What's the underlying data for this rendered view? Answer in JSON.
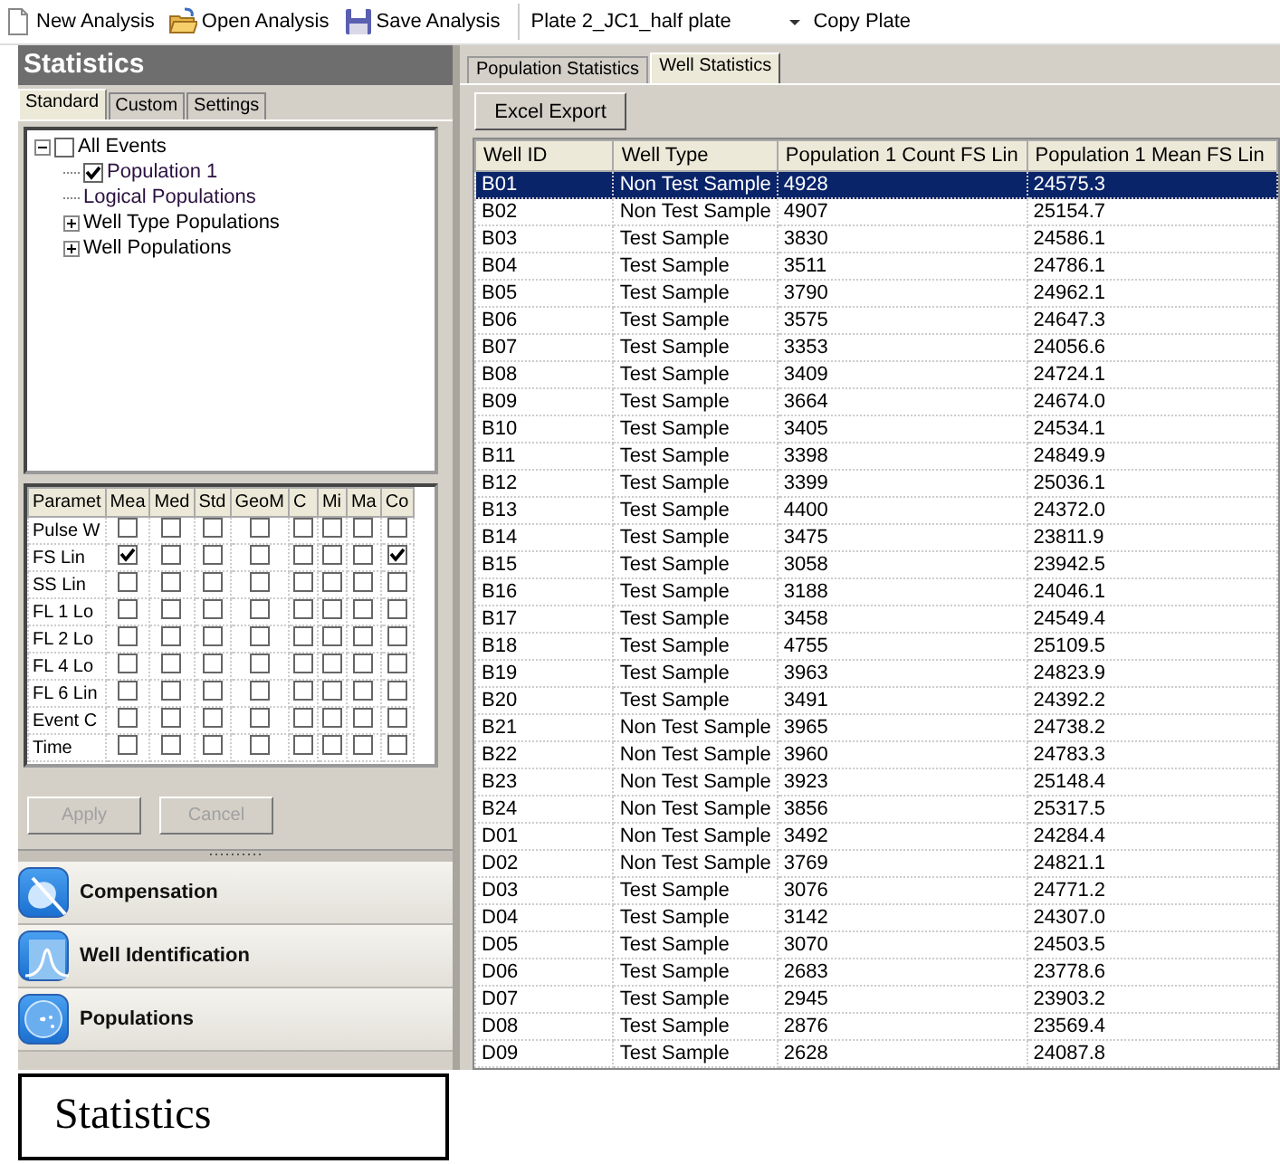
{
  "toolbar": {
    "buttons": [
      {
        "label": "New Analysis",
        "kind": "new"
      },
      {
        "label": "Open Analysis",
        "kind": "open"
      },
      {
        "label": "Save Analysis",
        "kind": "save"
      }
    ],
    "plate_select": {
      "value": "Plate 2_JC1_half plate"
    },
    "copy_plate": "Copy Plate"
  },
  "panel": {
    "title": "Statistics",
    "tabs": [
      {
        "label": "Standard",
        "selected": true
      },
      {
        "label": "Custom",
        "selected": false
      },
      {
        "label": "Settings",
        "selected": false
      }
    ],
    "tree": [
      {
        "label": "All Events",
        "kind": "checkgroup",
        "checked": false,
        "expanded": true,
        "children": [
          {
            "label": "Population 1",
            "kind": "check",
            "checked": true
          },
          {
            "label": "Logical Populations",
            "kind": "leaf"
          },
          {
            "label": "Well Type Populations",
            "kind": "group",
            "expanded": false
          },
          {
            "label": "Well Populations",
            "kind": "group",
            "expanded": false
          }
        ]
      }
    ],
    "param_columns": [
      "Paramet",
      "Mea",
      "Med",
      "Std",
      "GeoM",
      "C",
      "Mi",
      "Ma",
      "Co"
    ],
    "params": [
      {
        "name": "Pulse W",
        "checks": [
          false,
          false,
          false,
          false,
          false,
          false,
          false,
          false
        ]
      },
      {
        "name": "FS Lin",
        "checks": [
          true,
          false,
          false,
          false,
          false,
          false,
          false,
          true
        ]
      },
      {
        "name": "SS Lin",
        "checks": [
          false,
          false,
          false,
          false,
          false,
          false,
          false,
          false
        ]
      },
      {
        "name": "FL 1 Lo",
        "checks": [
          false,
          false,
          false,
          false,
          false,
          false,
          false,
          false
        ]
      },
      {
        "name": "FL 2 Lo",
        "checks": [
          false,
          false,
          false,
          false,
          false,
          false,
          false,
          false
        ]
      },
      {
        "name": "FL 4 Lo",
        "checks": [
          false,
          false,
          false,
          false,
          false,
          false,
          false,
          false
        ]
      },
      {
        "name": "FL 6 Lin",
        "checks": [
          false,
          false,
          false,
          false,
          false,
          false,
          false,
          false
        ]
      },
      {
        "name": "Event C",
        "checks": [
          false,
          false,
          false,
          false,
          false,
          false,
          false,
          false
        ]
      },
      {
        "name": "Time",
        "checks": [
          false,
          false,
          false,
          false,
          false,
          false,
          false,
          false
        ]
      }
    ],
    "buttons": [
      {
        "label": "Apply",
        "disabled": true
      },
      {
        "label": "Cancel",
        "disabled": true
      }
    ],
    "nav": [
      {
        "label": "Compensation",
        "kind": "compensation"
      },
      {
        "label": "Well Identification",
        "kind": "peak"
      },
      {
        "label": "Populations",
        "kind": "dots"
      }
    ]
  },
  "results": {
    "tabs": [
      {
        "label": "Population Statistics",
        "selected": false
      },
      {
        "label": "Well Statistics",
        "selected": true
      }
    ],
    "export_button": "Excel Export",
    "columns": [
      "Well ID",
      "Well Type",
      "Population 1 Count FS Lin",
      "Population 1 Mean FS Lin"
    ],
    "rows": [
      {
        "cells": [
          "B01",
          "Non Test Sample",
          "4928",
          "24575.3"
        ],
        "selected": true
      },
      {
        "cells": [
          "B02",
          "Non Test Sample",
          "4907",
          "25154.7"
        ],
        "selected": false
      },
      {
        "cells": [
          "B03",
          "Test Sample",
          "3830",
          "24586.1"
        ],
        "selected": false
      },
      {
        "cells": [
          "B04",
          "Test Sample",
          "3511",
          "24786.1"
        ],
        "selected": false
      },
      {
        "cells": [
          "B05",
          "Test Sample",
          "3790",
          "24962.1"
        ],
        "selected": false
      },
      {
        "cells": [
          "B06",
          "Test Sample",
          "3575",
          "24647.3"
        ],
        "selected": false
      },
      {
        "cells": [
          "B07",
          "Test Sample",
          "3353",
          "24056.6"
        ],
        "selected": false
      },
      {
        "cells": [
          "B08",
          "Test Sample",
          "3409",
          "24724.1"
        ],
        "selected": false
      },
      {
        "cells": [
          "B09",
          "Test Sample",
          "3664",
          "24674.0"
        ],
        "selected": false
      },
      {
        "cells": [
          "B10",
          "Test Sample",
          "3405",
          "24534.1"
        ],
        "selected": false
      },
      {
        "cells": [
          "B11",
          "Test Sample",
          "3398",
          "24849.9"
        ],
        "selected": false
      },
      {
        "cells": [
          "B12",
          "Test Sample",
          "3399",
          "25036.1"
        ],
        "selected": false
      },
      {
        "cells": [
          "B13",
          "Test Sample",
          "4400",
          "24372.0"
        ],
        "selected": false
      },
      {
        "cells": [
          "B14",
          "Test Sample",
          "3475",
          "23811.9"
        ],
        "selected": false
      },
      {
        "cells": [
          "B15",
          "Test Sample",
          "3058",
          "23942.5"
        ],
        "selected": false
      },
      {
        "cells": [
          "B16",
          "Test Sample",
          "3188",
          "24046.1"
        ],
        "selected": false
      },
      {
        "cells": [
          "B17",
          "Test Sample",
          "3458",
          "24549.4"
        ],
        "selected": false
      },
      {
        "cells": [
          "B18",
          "Test Sample",
          "4755",
          "25109.5"
        ],
        "selected": false
      },
      {
        "cells": [
          "B19",
          "Test Sample",
          "3963",
          "24823.9"
        ],
        "selected": false
      },
      {
        "cells": [
          "B20",
          "Test Sample",
          "3491",
          "24392.2"
        ],
        "selected": false
      },
      {
        "cells": [
          "B21",
          "Non Test Sample",
          "3965",
          "24738.2"
        ],
        "selected": false
      },
      {
        "cells": [
          "B22",
          "Non Test Sample",
          "3960",
          "24783.3"
        ],
        "selected": false
      },
      {
        "cells": [
          "B23",
          "Non Test Sample",
          "3923",
          "25148.4"
        ],
        "selected": false
      },
      {
        "cells": [
          "B24",
          "Non Test Sample",
          "3856",
          "25317.5"
        ],
        "selected": false
      },
      {
        "cells": [
          "D01",
          "Non Test Sample",
          "3492",
          "24284.4"
        ],
        "selected": false
      },
      {
        "cells": [
          "D02",
          "Non Test Sample",
          "3769",
          "24821.1"
        ],
        "selected": false
      },
      {
        "cells": [
          "D03",
          "Test Sample",
          "3076",
          "24771.2"
        ],
        "selected": false
      },
      {
        "cells": [
          "D04",
          "Test Sample",
          "3142",
          "24307.0"
        ],
        "selected": false
      },
      {
        "cells": [
          "D05",
          "Test Sample",
          "3070",
          "24503.5"
        ],
        "selected": false
      },
      {
        "cells": [
          "D06",
          "Test Sample",
          "2683",
          "23778.6"
        ],
        "selected": false
      },
      {
        "cells": [
          "D07",
          "Test Sample",
          "2945",
          "23903.2"
        ],
        "selected": false
      },
      {
        "cells": [
          "D08",
          "Test Sample",
          "2876",
          "23569.4"
        ],
        "selected": false
      },
      {
        "cells": [
          "D09",
          "Test Sample",
          "2628",
          "24087.8"
        ],
        "selected": false
      }
    ]
  },
  "caption": "Statistics"
}
